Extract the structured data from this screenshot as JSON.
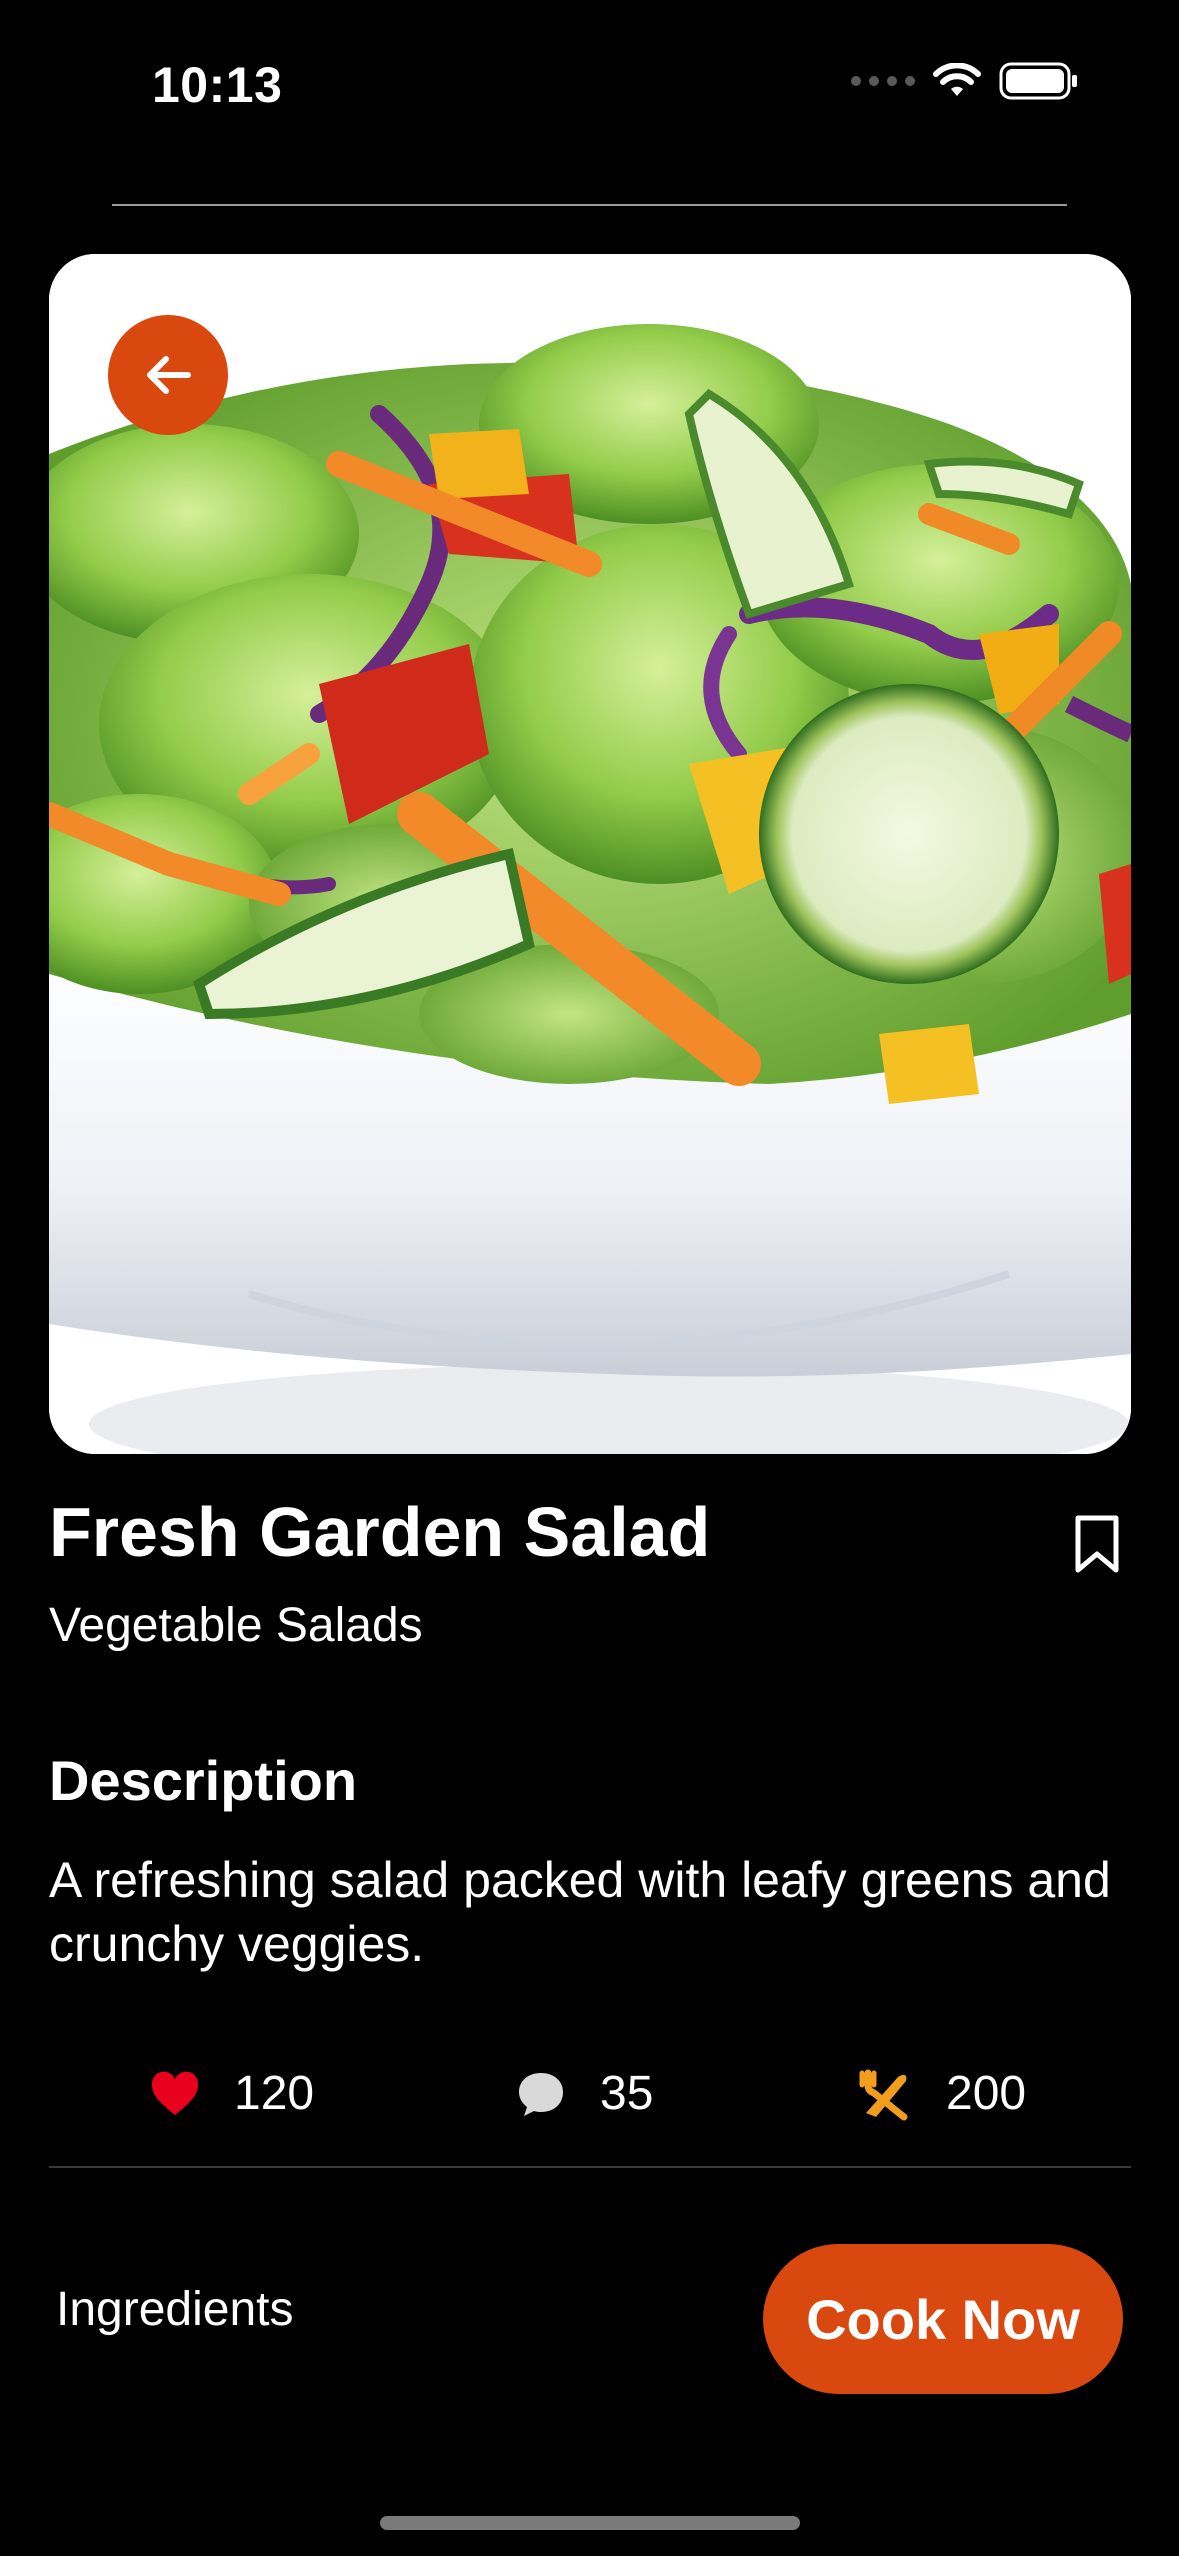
{
  "status_bar": {
    "time": "10:13"
  },
  "recipe": {
    "title": "Fresh Garden Salad",
    "category": "Vegetable Salads",
    "description_heading": "Description",
    "description": "A refreshing salad packed with leafy greens and crunchy veggies.",
    "image_alt": "Salad bowl with lettuce, cucumber, carrot, bell pepper and purple cabbage"
  },
  "stats": {
    "likes": "120",
    "comments": "35",
    "cooks": "200"
  },
  "actions": {
    "ingredients_label": "Ingredients",
    "cook_now_label": "Cook Now"
  },
  "icons": {
    "back": "arrow-left-icon",
    "bookmark": "bookmark-icon",
    "likes": "heart-icon",
    "comments": "chat-bubble-icon",
    "cooks": "fork-knife-icon"
  },
  "colors": {
    "accent": "#d9480f",
    "heart": "#e8001c",
    "utensils": "#f29d1b",
    "background": "#000000"
  }
}
